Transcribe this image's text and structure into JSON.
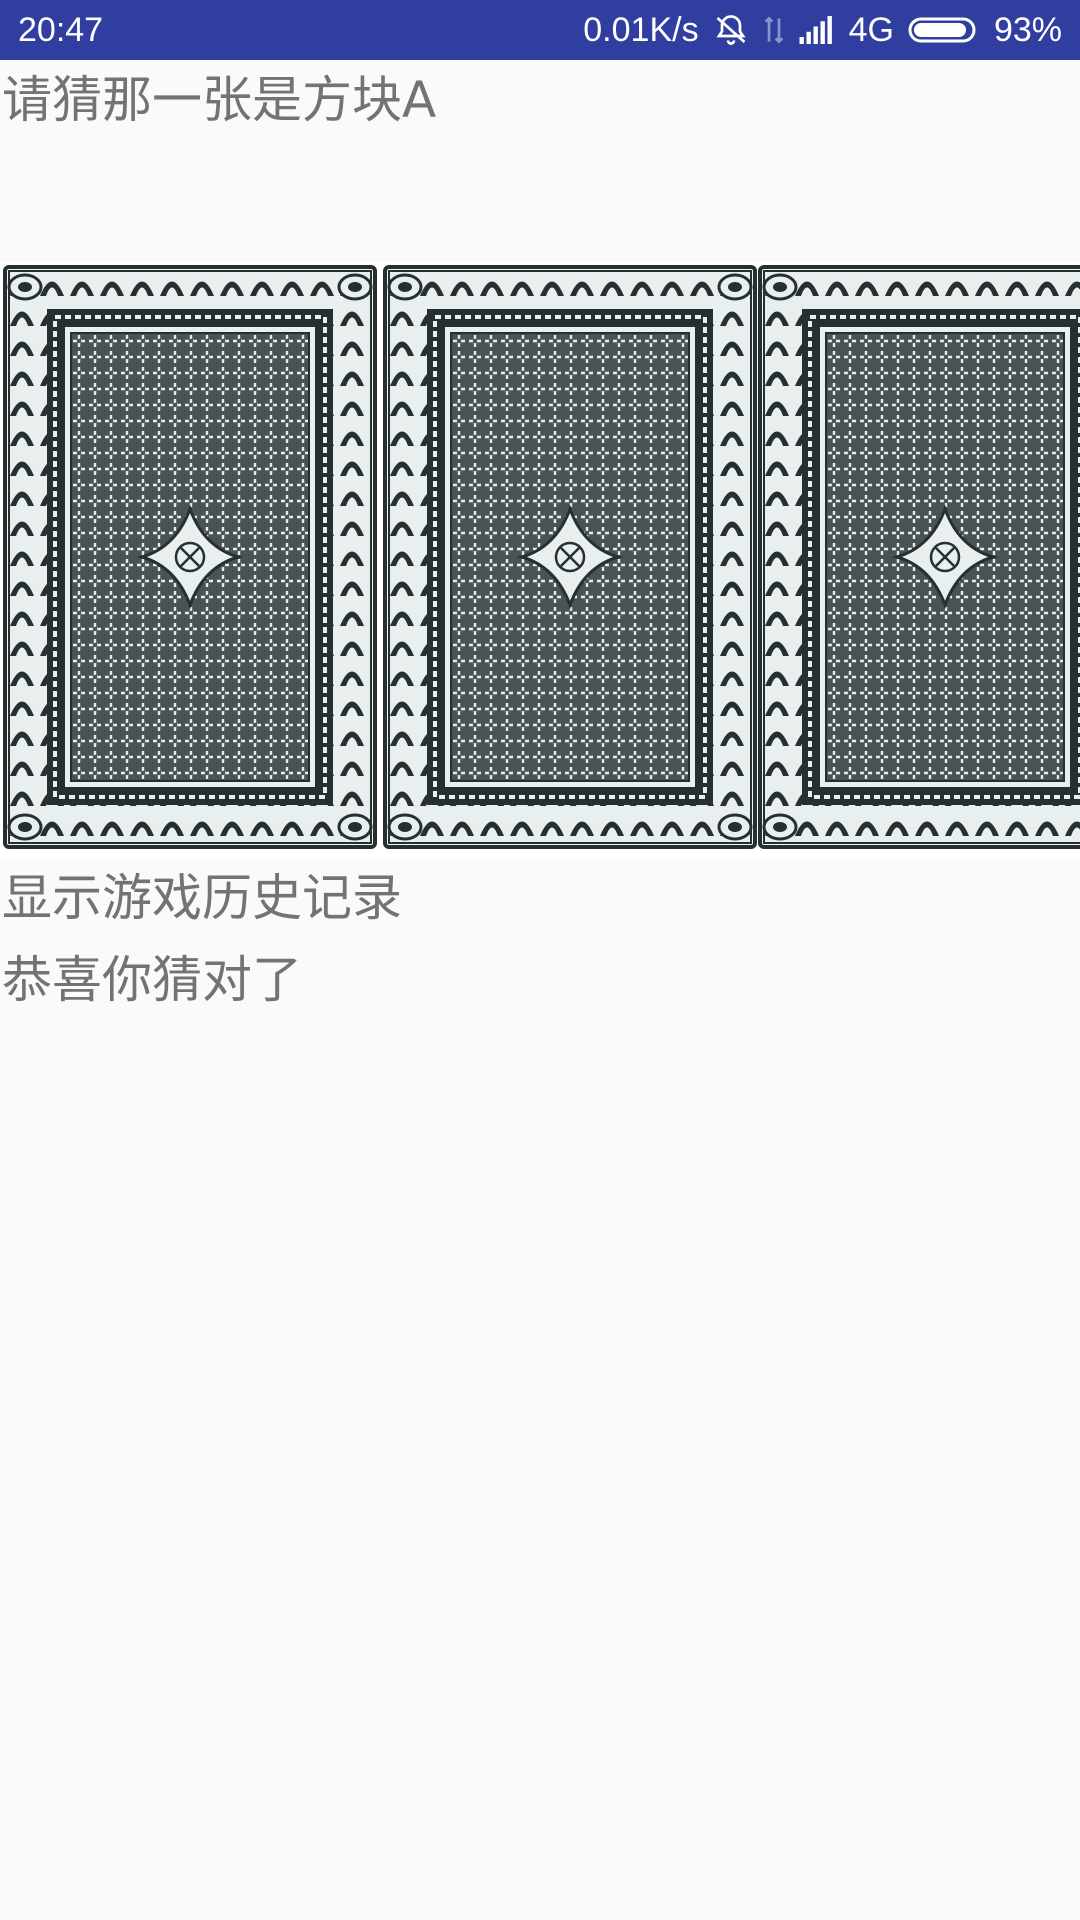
{
  "status_bar": {
    "time": "20:47",
    "net_speed": "0.01K/s",
    "network_type": "4G",
    "battery_percent": "93%",
    "battery_level": 0.93,
    "background_color": "#303f9f",
    "icons": [
      "alarm-off-icon",
      "data-transfer-icon",
      "signal-icon",
      "battery-icon"
    ]
  },
  "game": {
    "prompt": "请猜那一张是方块A",
    "history_label": "显示游戏历史记录",
    "result_text": "恭喜你猜对了"
  },
  "cards": [
    {
      "name": "card-1",
      "face": "back"
    },
    {
      "name": "card-2",
      "face": "back"
    },
    {
      "name": "card-3",
      "face": "back"
    }
  ],
  "colors": {
    "card_ink": "#263030",
    "text": "#737373",
    "background": "#fafafa"
  }
}
